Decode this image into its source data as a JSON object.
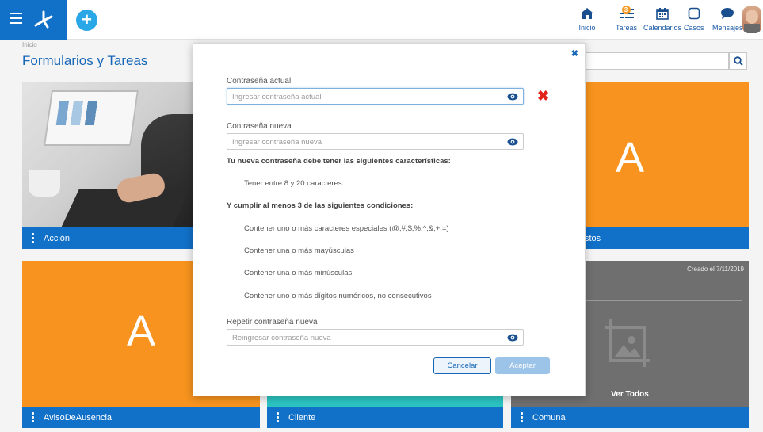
{
  "topbar": {
    "nav": [
      {
        "id": "inicio",
        "label": "Inicio",
        "icon": "home-icon"
      },
      {
        "id": "tareas",
        "label": "Tareas",
        "icon": "tasks-icon",
        "badge": "3"
      },
      {
        "id": "calendarios",
        "label": "Calendarios",
        "icon": "calendar-icon"
      },
      {
        "id": "casos",
        "label": "Casos",
        "icon": "case-icon"
      },
      {
        "id": "mensajes",
        "label": "Mensajes",
        "icon": "chat-icon"
      }
    ],
    "accent": "#1170c7"
  },
  "page": {
    "breadcrumb": "Inicio",
    "title": "Formularios y Tareas"
  },
  "tiles": {
    "accion": {
      "label": "Acción"
    },
    "top_right": {
      "letter": "A",
      "label_fragment": "stos",
      "color": "#f7931e"
    },
    "aviso": {
      "letter": "A",
      "label": "AvisoDeAusencia",
      "color": "#f7931e"
    },
    "cliente": {
      "label": "Cliente",
      "color": "#2bc4c1"
    },
    "comuna": {
      "label": "Comuna",
      "created": "Creado el 7/11/2019",
      "ver_todos": "Ver Todos"
    }
  },
  "modal": {
    "current": {
      "label": "Contraseña actual",
      "placeholder": "Ingresar contraseña actual"
    },
    "new": {
      "label": "Contraseña nueva",
      "placeholder": "Ingresar contraseña nueva"
    },
    "rules_title": "Tu nueva contraseña debe tener las siguientes características:",
    "rule_length": "Tener entre 8 y 20 caracteres",
    "conditions_title": "Y cumplir al menos 3 de las siguientes condiciones:",
    "conditions": [
      "Contener uno o más caracteres especiales (@,#,$,%,^,&,+,=)",
      "Contener una o más mayúsculas",
      "Contener una o más minúsculas",
      "Contener uno o más dígitos numéricos, no consecutivos"
    ],
    "repeat": {
      "label": "Repetir contraseña nueva",
      "placeholder": "Reingresar contraseña nueva"
    },
    "cancel_label": "Cancelar",
    "accept_label": "Aceptar",
    "error_color": "#e2231a"
  }
}
